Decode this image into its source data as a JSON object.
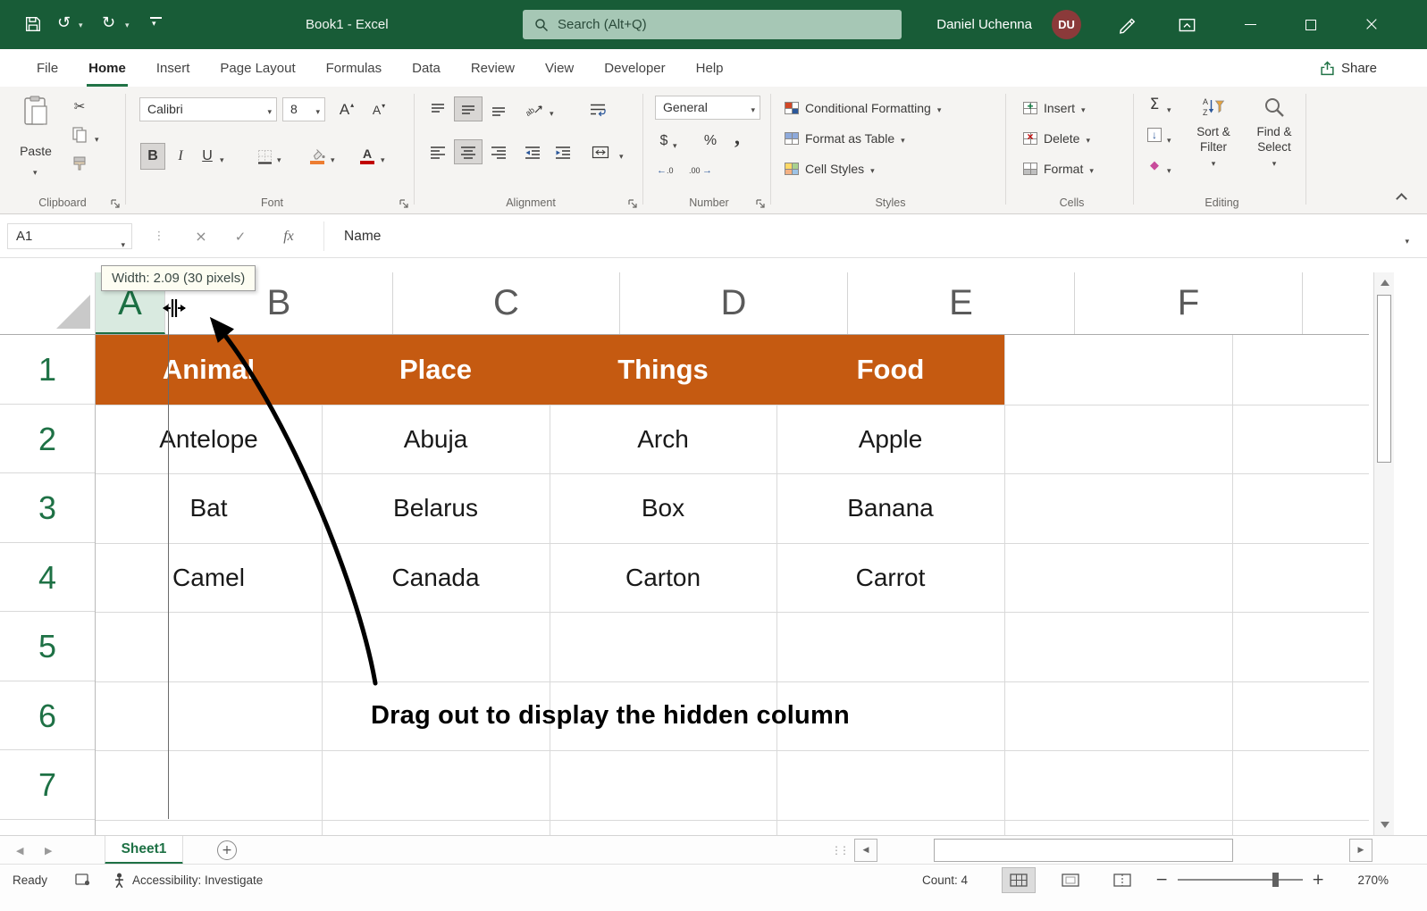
{
  "colors": {
    "titlebar_green": "#185C37",
    "accent_green": "#217346",
    "header_orange": "#C55A11",
    "avatar_maroon": "#8B3A3A"
  },
  "icons": {
    "chevron_down": "▾",
    "tri_up": "▴",
    "tri_down": "▾",
    "tri_left": "◀",
    "tri_right": "▶",
    "undo": "↺",
    "redo": "↻",
    "scissors": "✂",
    "check": "✓",
    "cancel": "×",
    "close": "×",
    "dots": "⋮",
    "plus": "+",
    "minus": "−",
    "diamond_clear": "◆",
    "arrow_down": "↓",
    "insert_plus": "+",
    "delete_x": "×"
  },
  "titlebar": {
    "title": "Book1  -  Excel",
    "search_placeholder": "Search (Alt+Q)",
    "user_name": "Daniel Uchenna",
    "user_initials": "DU"
  },
  "ribbon_tabs": {
    "items": [
      "File",
      "Home",
      "Insert",
      "Page Layout",
      "Formulas",
      "Data",
      "Review",
      "View",
      "Developer",
      "Help"
    ],
    "active": "Home",
    "share_label": "Share"
  },
  "ribbon": {
    "groups": [
      "Clipboard",
      "Font",
      "Alignment",
      "Number",
      "Styles",
      "Cells",
      "Editing"
    ],
    "paste_label": "Paste",
    "font_name": "Calibri",
    "font_size": "8",
    "number_format": "General",
    "styles_buttons": [
      "Conditional Formatting",
      "Format as Table",
      "Cell Styles"
    ],
    "cells_buttons": [
      "Insert",
      "Delete",
      "Format"
    ],
    "editing_buttons": [
      "Sort & Filter",
      "Find & Select"
    ],
    "glyphs": {
      "bold": "B",
      "italic": "I",
      "underline": "U",
      "autosum": "Σ",
      "currency": "$",
      "percent": "%",
      "comma": ",",
      "fx": "fx",
      "font_grow": "A",
      "font_shrink": "A",
      "orientation": "ab",
      "wrap": "ab"
    }
  },
  "formula_bar": {
    "name_box": "A1",
    "formula": "Name"
  },
  "sheet": {
    "tooltip": "Width: 2.09 (30 pixels)",
    "columns": [
      "A",
      "B",
      "C",
      "D",
      "E",
      "F"
    ],
    "rows": [
      "1",
      "2",
      "3",
      "4",
      "5",
      "6",
      "7"
    ],
    "header_row": [
      "Animal",
      "Place",
      "Things",
      "Food"
    ],
    "data_rows": [
      [
        "Antelope",
        "Abuja",
        "Arch",
        "Apple"
      ],
      [
        "Bat",
        "Belarus",
        "Box",
        "Banana"
      ],
      [
        "Camel",
        "Canada",
        "Carton",
        "Carrot"
      ]
    ],
    "annotation": "Drag out to display the hidden column"
  },
  "tabbar": {
    "sheet_name": "Sheet1"
  },
  "statusbar": {
    "ready": "Ready",
    "accessibility": "Accessibility: Investigate",
    "count": "Count: 4",
    "zoom": "270%"
  }
}
